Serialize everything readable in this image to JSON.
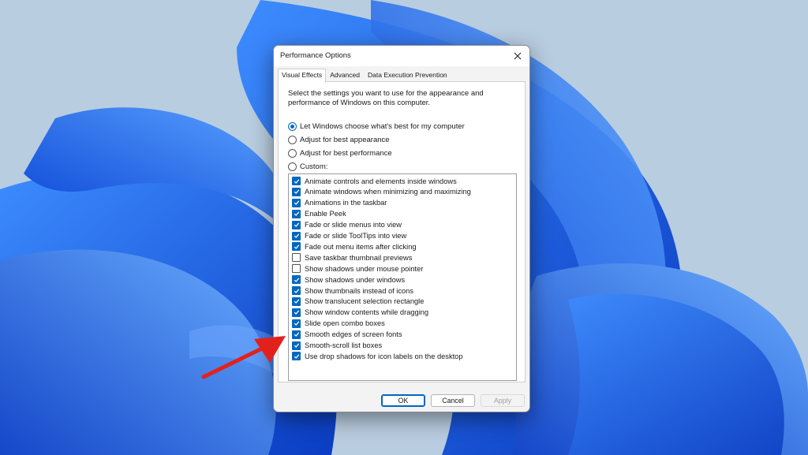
{
  "dialog": {
    "title": "Performance Options",
    "close_icon": "close-icon",
    "tabs": [
      {
        "label": "Visual Effects",
        "active": true
      },
      {
        "label": "Advanced",
        "active": false
      },
      {
        "label": "Data Execution Prevention",
        "active": false
      }
    ],
    "intro": "Select the settings you want to use for the appearance and performance of Windows on this computer.",
    "options": [
      {
        "label": "Let Windows choose what's best for my computer",
        "selected": true
      },
      {
        "label": "Adjust for best appearance",
        "selected": false
      },
      {
        "label": "Adjust for best performance",
        "selected": false
      },
      {
        "label": "Custom:",
        "selected": false
      }
    ],
    "effects": [
      {
        "label": "Animate controls and elements inside windows",
        "checked": true
      },
      {
        "label": "Animate windows when minimizing and maximizing",
        "checked": true
      },
      {
        "label": "Animations in the taskbar",
        "checked": true
      },
      {
        "label": "Enable Peek",
        "checked": true
      },
      {
        "label": "Fade or slide menus into view",
        "checked": true
      },
      {
        "label": "Fade or slide ToolTips into view",
        "checked": true
      },
      {
        "label": "Fade out menu items after clicking",
        "checked": true
      },
      {
        "label": "Save taskbar thumbnail previews",
        "checked": false
      },
      {
        "label": "Show shadows under mouse pointer",
        "checked": false
      },
      {
        "label": "Show shadows under windows",
        "checked": true
      },
      {
        "label": "Show thumbnails instead of icons",
        "checked": true
      },
      {
        "label": "Show translucent selection rectangle",
        "checked": true
      },
      {
        "label": "Show window contents while dragging",
        "checked": true
      },
      {
        "label": "Slide open combo boxes",
        "checked": true
      },
      {
        "label": "Smooth edges of screen fonts",
        "checked": true
      },
      {
        "label": "Smooth-scroll list boxes",
        "checked": true
      },
      {
        "label": "Use drop shadows for icon labels on the desktop",
        "checked": true
      }
    ],
    "buttons": {
      "ok": "OK",
      "cancel": "Cancel",
      "apply": "Apply"
    }
  },
  "colors": {
    "accent": "#0067c0",
    "arrow": "#e3211c",
    "wallpaper_bg": "#b9cde0",
    "bloom_blue": "#1b63e8"
  }
}
